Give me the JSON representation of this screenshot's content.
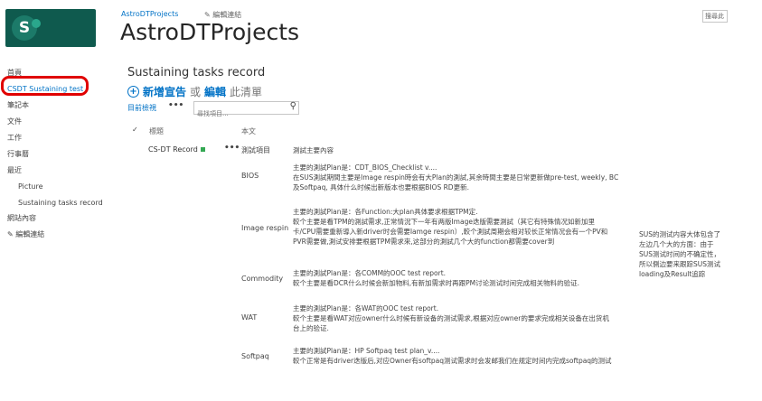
{
  "site": {
    "link": "AstroDTProjects",
    "edit_links": "編輯連結",
    "title": "AstroDTProjects",
    "logo_letter": "S",
    "search_placeholder": "搜尋此"
  },
  "quick_launch": {
    "items": [
      {
        "label": "首頁"
      },
      {
        "label": "CSDT Sustaining test"
      },
      {
        "label": "筆記本"
      },
      {
        "label": "文件"
      },
      {
        "label": "工作"
      },
      {
        "label": "行事曆"
      },
      {
        "label": "最近"
      },
      {
        "label": "Picture"
      },
      {
        "label": "Sustaining tasks record"
      },
      {
        "label": "網站內容"
      }
    ],
    "edit_links": "編輯連結"
  },
  "list": {
    "title": "Sustaining tasks record",
    "new_item_bold": "新增宣告",
    "new_item_or": "或",
    "new_item_edit": "編輯",
    "new_item_tail": "此清單",
    "view_label": "目前檢視",
    "ellipsis": "•••",
    "find_placeholder": "尋找項目...",
    "col_title": "標題",
    "col_body": "本文",
    "item": {
      "title": "CS-DT Record",
      "header_left": "測試項目",
      "header_right": "測試主要內容",
      "rows": [
        {
          "label": "BIOS",
          "lines": [
            "主要的測試Plan是：CDT_BIOS_Checklist v....",
            "在SUS測試期間主要是Image respin時会有大Plan的測試,其余時間主要是日常更新做pre-test, weekly, BC",
            "及Softpaq, 具体什么时候出新版本也要根据BIOS RD更新."
          ]
        },
        {
          "label": "Image respin",
          "lines": [
            "主要的測試Plan是：各Function:大plan具体要求根据TPM定.",
            "較个主要是看TPM的測試需求,正常情況下一年有两版Image迭版需要測試（其它有特殊情况如新加里",
            "卡/CPU需要重新導入新driver时会需要Iamge respin）,較个測試周期会相对较长正常情况会有一个PV和",
            "PVR需要做,測试安排要根据TPM需求來,这部分的測試几个大的function都需要cover到"
          ]
        },
        {
          "label": "Commodity",
          "lines": [
            "主要的測試Plan是：各COMM的OOC test report.",
            "較个主要是看DCR什么时候会新加物料,有新加需求时再跟PM讨论测试时间完成相关物料的验证."
          ]
        },
        {
          "label": "WAT",
          "lines": [
            "主要的測試Plan是：各WAT的OOC test report.",
            "較个主要是看WAT对应owner什么时候有新设备的测试需求,根据对应owner的要求完成相关设备在出货机",
            "台上的验证."
          ]
        },
        {
          "label": "Softpaq",
          "lines": [
            "主要的測試Plan是：HP Softpaq test plan_v....",
            "較个正常是有driver迭版后,对应Owner有softpaq测试需求时会发邮我们在规定时间内完成softpaq的测试"
          ]
        }
      ],
      "side_note": "SUS的测试内容大体包含了左边几个大的方面：由于SUS测试时间的不确定性，所以側边要来跟踪SUS测试loading及Result追踪"
    }
  }
}
